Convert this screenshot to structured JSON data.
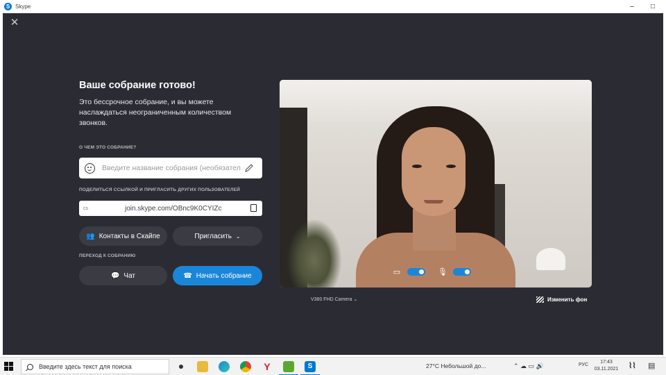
{
  "window": {
    "title": "Skype"
  },
  "meeting": {
    "heading": "Ваше собрание готово!",
    "description": "Это бессрочное собрание, и вы можете наслаждаться неограниченным количеством звонков.",
    "about_label": "О ЧЕМ ЭТО СОБРАНИЕ?",
    "name_placeholder": "Введите название собрания (необязательно)",
    "share_label": "ПОДЕЛИТЬСЯ ССЫЛКОЙ И ПРИГЛАСИТЬ ДРУГИХ ПОЛЬЗОВАТЕЛЕЙ",
    "link_prefix": "сs",
    "link": "join.skype.com/OBnc9K0CYIZc",
    "contacts_button": "Контакты в Скайпе",
    "invite_button": "Пригласить",
    "goto_label": "ПЕРЕХОД К СОБРАНИЮ",
    "chat_button": "Чат",
    "start_button": "Начать собрание"
  },
  "video": {
    "camera_name": "V380 FHD Camera",
    "change_background": "Изменить фон",
    "camera_enabled": true,
    "mic_enabled": true
  },
  "taskbar": {
    "search_placeholder": "Введите здесь текст для поиска",
    "notification": "27°C  Небольшой до...",
    "lang": "РУС",
    "time": "17:43",
    "date": "03.11.2021"
  },
  "colors": {
    "accent": "#1a86d9",
    "background": "#2b2c33",
    "button": "#3a3b43"
  }
}
